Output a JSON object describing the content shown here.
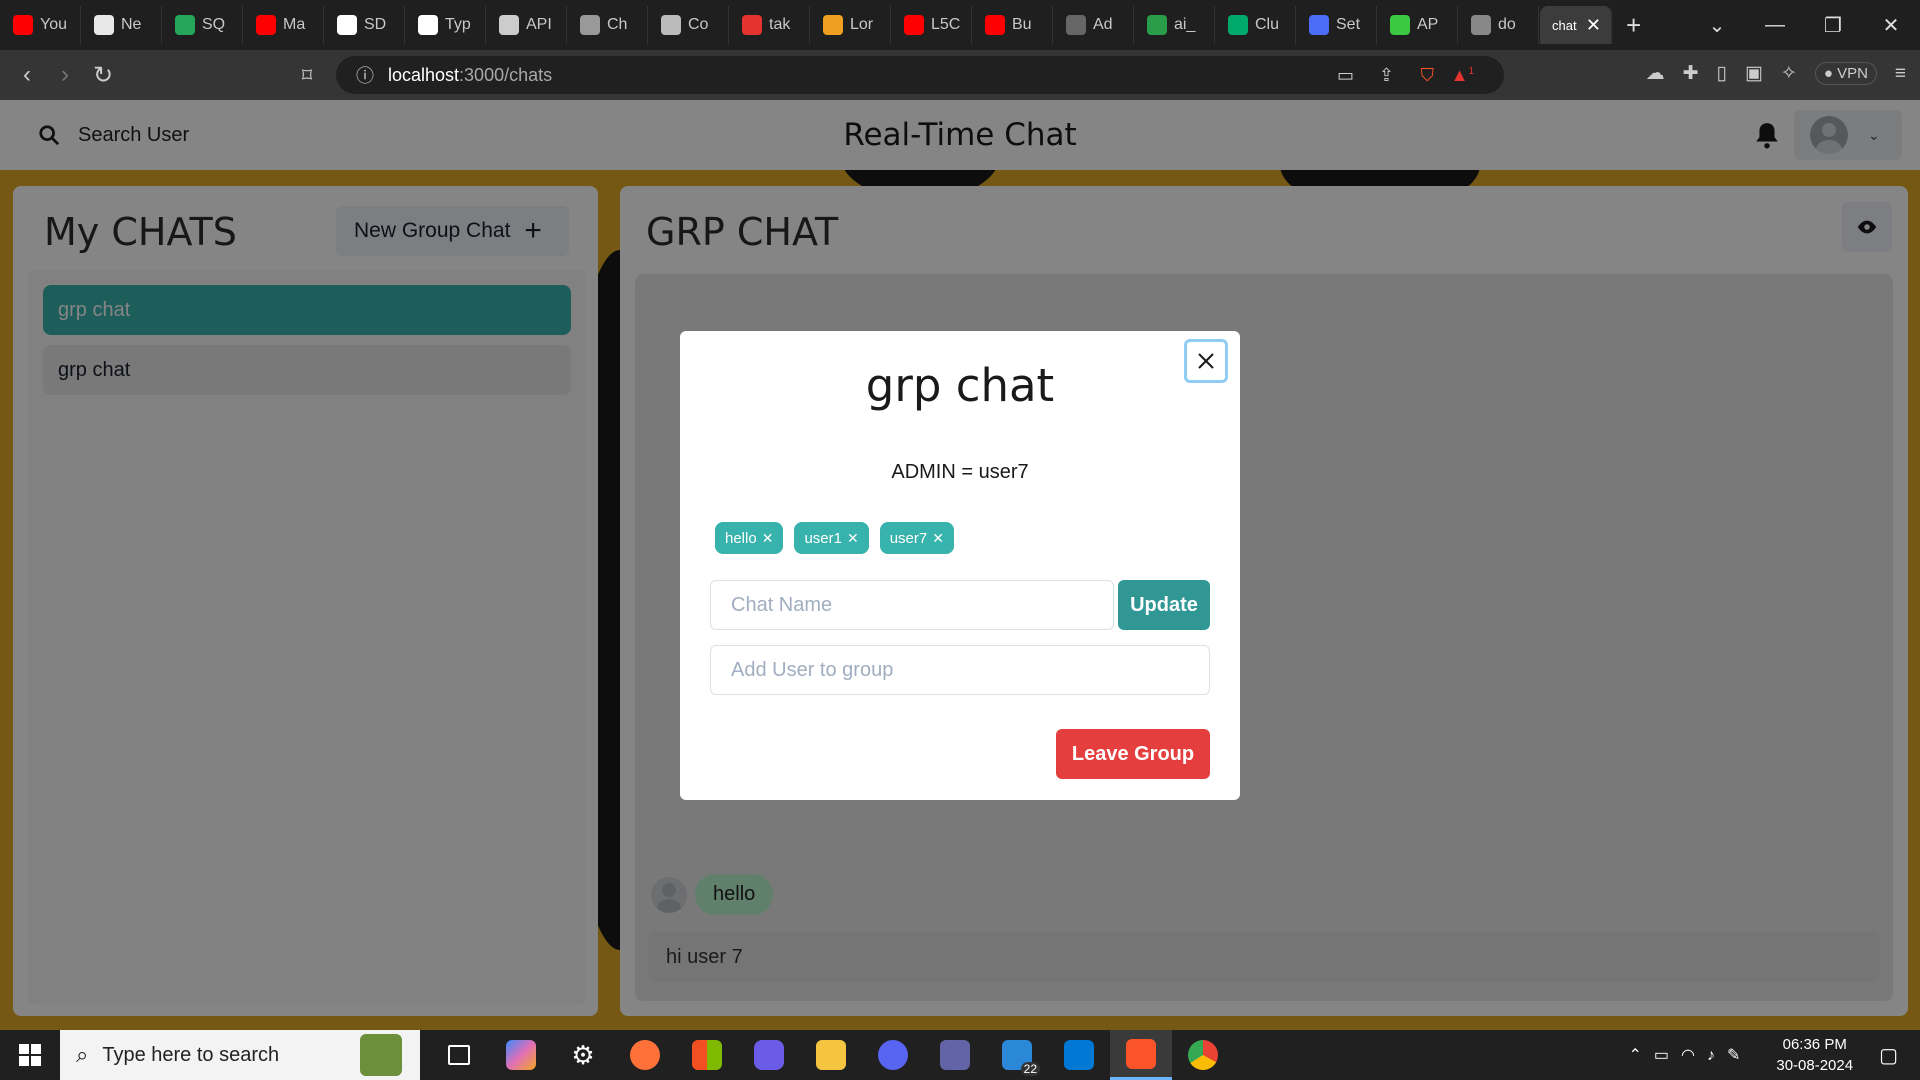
{
  "browser": {
    "tabs": [
      {
        "label": "You",
        "color": "#ff0000"
      },
      {
        "label": "Ne",
        "color": "#e8e8e8"
      },
      {
        "label": "SQ",
        "color": "#26a65b"
      },
      {
        "label": "Ma",
        "color": "#ff0000"
      },
      {
        "label": "SD",
        "color": "#ffffff"
      },
      {
        "label": "Typ",
        "color": "#ffffff"
      },
      {
        "label": "API",
        "color": "#cccccc"
      },
      {
        "label": "Ch",
        "color": "#999999"
      },
      {
        "label": "Co",
        "color": "#bbbbbb"
      },
      {
        "label": "tak",
        "color": "#e5342f"
      },
      {
        "label": "Lor",
        "color": "#f0a020"
      },
      {
        "label": "L5C",
        "color": "#ff0000"
      },
      {
        "label": "Bu",
        "color": "#ff0000"
      },
      {
        "label": "Ad",
        "color": "#666666"
      },
      {
        "label": "ai_",
        "color": "#2a9d4a"
      },
      {
        "label": "Clu",
        "color": "#00a86b"
      },
      {
        "label": "Set",
        "color": "#4a6cf7"
      },
      {
        "label": "AP",
        "color": "#3ac940"
      },
      {
        "label": "do",
        "color": "#888888"
      }
    ],
    "active_tab_label": "chat",
    "url_host": "localhost",
    "url_path": ":3000/chats",
    "vpn_label": "VPN",
    "notification_count": "1"
  },
  "app": {
    "search_label": "Search User",
    "title": "Real-Time Chat"
  },
  "sidebar": {
    "title": "My CHATS",
    "new_group_label": "New Group Chat",
    "chats": [
      {
        "name": "grp chat",
        "selected": true
      },
      {
        "name": "grp chat",
        "selected": false
      }
    ]
  },
  "chat": {
    "title": "GRP CHAT",
    "messages": [
      {
        "text": "hello"
      }
    ],
    "input_value": "hi user 7"
  },
  "modal": {
    "title": "grp chat",
    "admin_text": "ADMIN = user7",
    "members": [
      "hello",
      "user1",
      "user7"
    ],
    "chat_name_placeholder": "Chat Name",
    "update_label": "Update",
    "add_user_placeholder": "Add User to group",
    "leave_label": "Leave Group"
  },
  "taskbar": {
    "search_placeholder": "Type here to search",
    "time": "06:36 PM",
    "date": "30-08-2024",
    "mail_badge": "22"
  },
  "colors": {
    "accent_teal": "#38b2ac",
    "update_teal": "#319795",
    "leave_red": "#e53e3e",
    "message_bubble": "#b9f5d0"
  }
}
